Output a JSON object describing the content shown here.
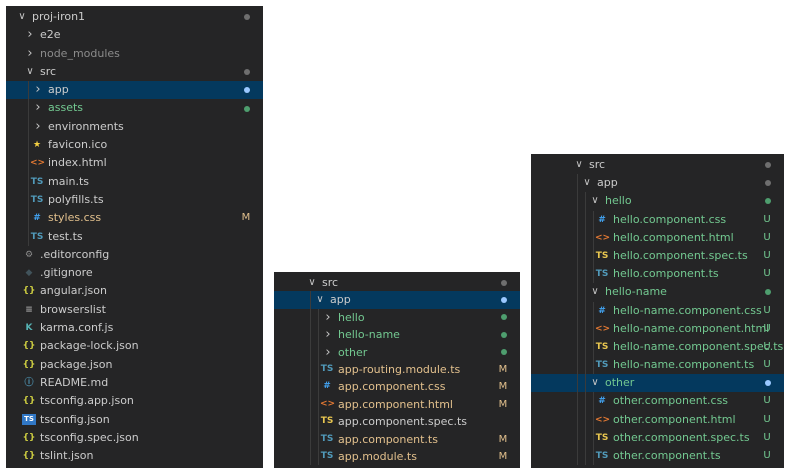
{
  "colors": {
    "default": "#cccccc",
    "dim": "#8b8b8b",
    "untracked": "#73c991",
    "modified": "#e2c08d",
    "selected_bg": "#04395e",
    "folder_dot": "#6f6f6f",
    "green_dot": "#4e9e6e",
    "blue_dot": "#9ac8ff"
  },
  "panels": [
    {
      "rows": [
        {
          "depth": 0,
          "type": "folder",
          "open": true,
          "name": "proj-iron1",
          "color": "default",
          "status": "dot"
        },
        {
          "depth": 1,
          "type": "folder",
          "open": false,
          "name": "e2e",
          "color": "default"
        },
        {
          "depth": 1,
          "type": "folder",
          "open": false,
          "name": "node_modules",
          "color": "dim"
        },
        {
          "depth": 1,
          "type": "folder",
          "open": true,
          "name": "src",
          "color": "default",
          "status": "dot"
        },
        {
          "depth": 2,
          "type": "folder",
          "open": false,
          "name": "app",
          "color": "default",
          "status": "dot-blue",
          "selected": true
        },
        {
          "depth": 2,
          "type": "folder",
          "open": false,
          "name": "assets",
          "color": "untracked",
          "status": "dot-green"
        },
        {
          "depth": 2,
          "type": "folder",
          "open": false,
          "name": "environments",
          "color": "default"
        },
        {
          "depth": 2,
          "type": "file",
          "icon": "star-icon",
          "name": "favicon.ico",
          "color": "default"
        },
        {
          "depth": 2,
          "type": "file",
          "icon": "html-icon",
          "name": "index.html",
          "color": "default"
        },
        {
          "depth": 2,
          "type": "file",
          "icon": "ts-icon",
          "name": "main.ts",
          "color": "default"
        },
        {
          "depth": 2,
          "type": "file",
          "icon": "ts-icon",
          "name": "polyfills.ts",
          "color": "default"
        },
        {
          "depth": 2,
          "type": "file",
          "icon": "css-icon",
          "name": "styles.css",
          "color": "modified",
          "status": "M"
        },
        {
          "depth": 2,
          "type": "file",
          "icon": "ts-icon",
          "name": "test.ts",
          "color": "default"
        },
        {
          "depth": 1,
          "type": "file",
          "icon": "gear-icon",
          "name": ".editorconfig",
          "color": "default"
        },
        {
          "depth": 1,
          "type": "file",
          "icon": "git-icon",
          "name": ".gitignore",
          "color": "default"
        },
        {
          "depth": 1,
          "type": "file",
          "icon": "json-icon",
          "name": "angular.json",
          "color": "default"
        },
        {
          "depth": 1,
          "type": "file",
          "icon": "list-icon",
          "name": "browserslist",
          "color": "default"
        },
        {
          "depth": 1,
          "type": "file",
          "icon": "karma-icon",
          "name": "karma.conf.js",
          "color": "default"
        },
        {
          "depth": 1,
          "type": "file",
          "icon": "json-icon",
          "name": "package-lock.json",
          "color": "default"
        },
        {
          "depth": 1,
          "type": "file",
          "icon": "json-icon",
          "name": "package.json",
          "color": "default"
        },
        {
          "depth": 1,
          "type": "file",
          "icon": "info-icon",
          "name": "README.md",
          "color": "default"
        },
        {
          "depth": 1,
          "type": "file",
          "icon": "json-icon",
          "name": "tsconfig.app.json",
          "color": "default"
        },
        {
          "depth": 1,
          "type": "file",
          "icon": "tsconfig-icon",
          "name": "tsconfig.json",
          "color": "default"
        },
        {
          "depth": 1,
          "type": "file",
          "icon": "json-icon",
          "name": "tsconfig.spec.json",
          "color": "default"
        },
        {
          "depth": 1,
          "type": "file",
          "icon": "json-icon",
          "name": "tslint.json",
          "color": "default"
        }
      ]
    },
    {
      "rows": [
        {
          "depth": 1,
          "type": "folder",
          "open": true,
          "name": "src",
          "color": "default",
          "status": "dot"
        },
        {
          "depth": 2,
          "type": "folder",
          "open": true,
          "name": "app",
          "color": "default",
          "status": "dot-blue",
          "selected": true
        },
        {
          "depth": 3,
          "type": "folder",
          "open": false,
          "name": "hello",
          "color": "untracked",
          "status": "dot-green"
        },
        {
          "depth": 3,
          "type": "folder",
          "open": false,
          "name": "hello-name",
          "color": "untracked",
          "status": "dot-green"
        },
        {
          "depth": 3,
          "type": "folder",
          "open": false,
          "name": "other",
          "color": "untracked",
          "status": "dot-green"
        },
        {
          "depth": 3,
          "type": "file",
          "icon": "ts-icon",
          "name": "app-routing.module.ts",
          "color": "modified",
          "status": "M"
        },
        {
          "depth": 3,
          "type": "file",
          "icon": "css-icon",
          "name": "app.component.css",
          "color": "modified",
          "status": "M"
        },
        {
          "depth": 3,
          "type": "file",
          "icon": "html-icon",
          "name": "app.component.html",
          "color": "modified",
          "status": "M"
        },
        {
          "depth": 3,
          "type": "file",
          "icon": "ts-spec-icon",
          "name": "app.component.spec.ts",
          "color": "default"
        },
        {
          "depth": 3,
          "type": "file",
          "icon": "ts-icon",
          "name": "app.component.ts",
          "color": "modified",
          "status": "M"
        },
        {
          "depth": 3,
          "type": "file",
          "icon": "ts-icon",
          "name": "app.module.ts",
          "color": "modified",
          "status": "M"
        }
      ]
    },
    {
      "rows": [
        {
          "depth": 1,
          "type": "folder",
          "open": true,
          "name": "src",
          "color": "default",
          "status": "dot"
        },
        {
          "depth": 2,
          "type": "folder",
          "open": true,
          "name": "app",
          "color": "default",
          "status": "dot"
        },
        {
          "depth": 3,
          "type": "folder",
          "open": true,
          "name": "hello",
          "color": "untracked",
          "status": "dot-green"
        },
        {
          "depth": 4,
          "type": "file",
          "icon": "css-icon",
          "name": "hello.component.css",
          "color": "untracked",
          "status": "U"
        },
        {
          "depth": 4,
          "type": "file",
          "icon": "html-icon",
          "name": "hello.component.html",
          "color": "untracked",
          "status": "U"
        },
        {
          "depth": 4,
          "type": "file",
          "icon": "ts-spec-icon",
          "name": "hello.component.spec.ts",
          "color": "untracked",
          "status": "U"
        },
        {
          "depth": 4,
          "type": "file",
          "icon": "ts-icon",
          "name": "hello.component.ts",
          "color": "untracked",
          "status": "U"
        },
        {
          "depth": 3,
          "type": "folder",
          "open": true,
          "name": "hello-name",
          "color": "untracked",
          "status": "dot-green"
        },
        {
          "depth": 4,
          "type": "file",
          "icon": "css-icon",
          "name": "hello-name.component.css",
          "color": "untracked",
          "status": "U"
        },
        {
          "depth": 4,
          "type": "file",
          "icon": "html-icon",
          "name": "hello-name.component.html",
          "color": "untracked",
          "status": "U"
        },
        {
          "depth": 4,
          "type": "file",
          "icon": "ts-spec-icon",
          "name": "hello-name.component.spec.ts",
          "color": "untracked",
          "status": "U"
        },
        {
          "depth": 4,
          "type": "file",
          "icon": "ts-icon",
          "name": "hello-name.component.ts",
          "color": "untracked",
          "status": "U"
        },
        {
          "depth": 3,
          "type": "folder",
          "open": true,
          "name": "other",
          "color": "untracked",
          "status": "dot-blue",
          "selected": true
        },
        {
          "depth": 4,
          "type": "file",
          "icon": "css-icon",
          "name": "other.component.css",
          "color": "untracked",
          "status": "U"
        },
        {
          "depth": 4,
          "type": "file",
          "icon": "html-icon",
          "name": "other.component.html",
          "color": "untracked",
          "status": "U"
        },
        {
          "depth": 4,
          "type": "file",
          "icon": "ts-spec-icon",
          "name": "other.component.spec.ts",
          "color": "untracked",
          "status": "U"
        },
        {
          "depth": 4,
          "type": "file",
          "icon": "ts-icon",
          "name": "other.component.ts",
          "color": "untracked",
          "status": "U"
        }
      ]
    }
  ]
}
